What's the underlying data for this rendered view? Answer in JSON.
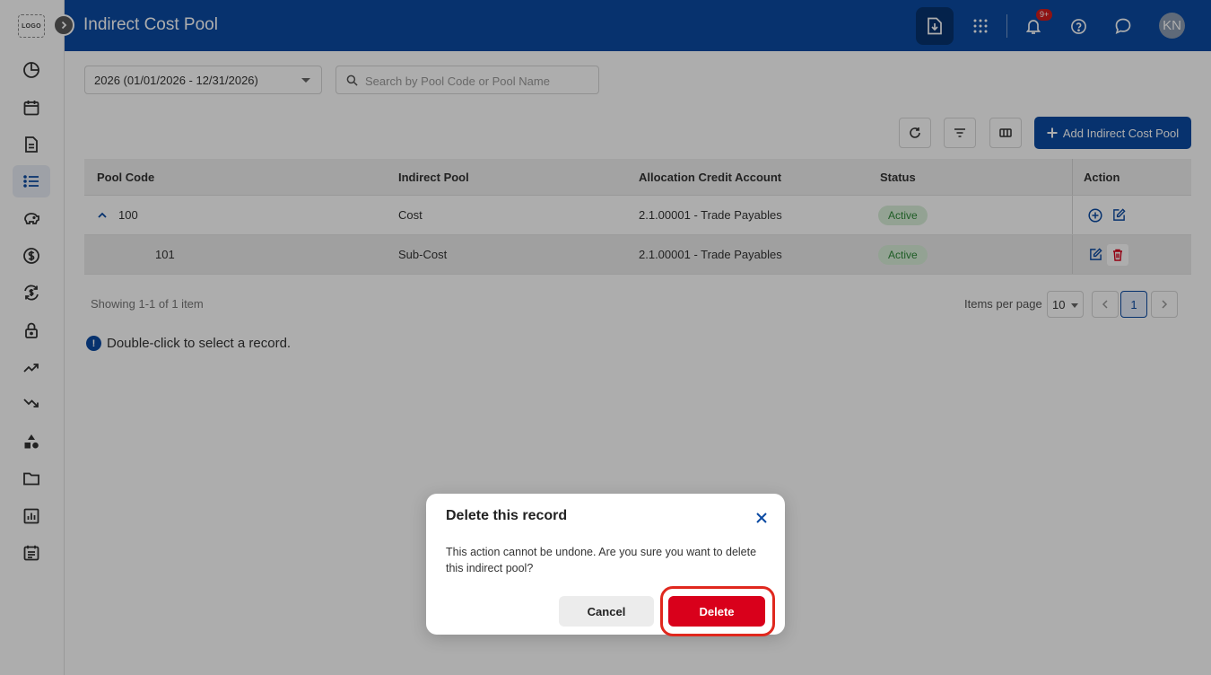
{
  "app": {
    "logo_text": "LOGO",
    "page_title": "Indirect Cost Pool",
    "notifications_badge": "9+",
    "user_initials": "KN"
  },
  "sidebar": {
    "items": [
      {
        "icon": "pie-chart-icon"
      },
      {
        "icon": "calendar-icon"
      },
      {
        "icon": "document-icon"
      },
      {
        "icon": "list-icon",
        "active": true
      },
      {
        "icon": "piggy-bank-icon"
      },
      {
        "icon": "dollar-circle-icon"
      },
      {
        "icon": "currency-exchange-icon"
      },
      {
        "icon": "lock-icon"
      },
      {
        "icon": "trending-up-icon"
      },
      {
        "icon": "trending-down-icon"
      },
      {
        "icon": "shapes-icon"
      },
      {
        "icon": "folder-icon"
      },
      {
        "icon": "bar-chart-icon"
      },
      {
        "icon": "schedule-icon"
      }
    ]
  },
  "filters": {
    "year_value": "2026 (01/01/2026 - 12/31/2026)",
    "search_placeholder": "Search by Pool Code or Pool Name"
  },
  "toolbar": {
    "add_label": "Add Indirect Cost Pool"
  },
  "table": {
    "columns": [
      "Pool Code",
      "Indirect Pool",
      "Allocation Credit Account",
      "Status",
      "Action"
    ],
    "rows": [
      {
        "pool_code": "100",
        "indirect_pool": "Cost",
        "account": "2.1.00001 - Trade Payables",
        "status": "Active",
        "expanded": true
      },
      {
        "pool_code": "101",
        "indirect_pool": "Sub-Cost",
        "account": "2.1.00001 - Trade Payables",
        "status": "Active",
        "child": true,
        "selected": true
      }
    ]
  },
  "pagination": {
    "showing": "Showing 1-1 of 1 item",
    "items_per_page_label": "Items per page",
    "items_per_page": "10",
    "current_page": "1"
  },
  "hint": {
    "icon_text": "!",
    "text": "Double-click to select a record."
  },
  "modal": {
    "title": "Delete this record",
    "body": "This action cannot be undone. Are you sure you want to delete this indirect pool?",
    "cancel_label": "Cancel",
    "delete_label": "Delete"
  },
  "colors": {
    "brand": "#0b4aa2",
    "danger": "#d9001b",
    "active_status": "#2e8a38"
  }
}
